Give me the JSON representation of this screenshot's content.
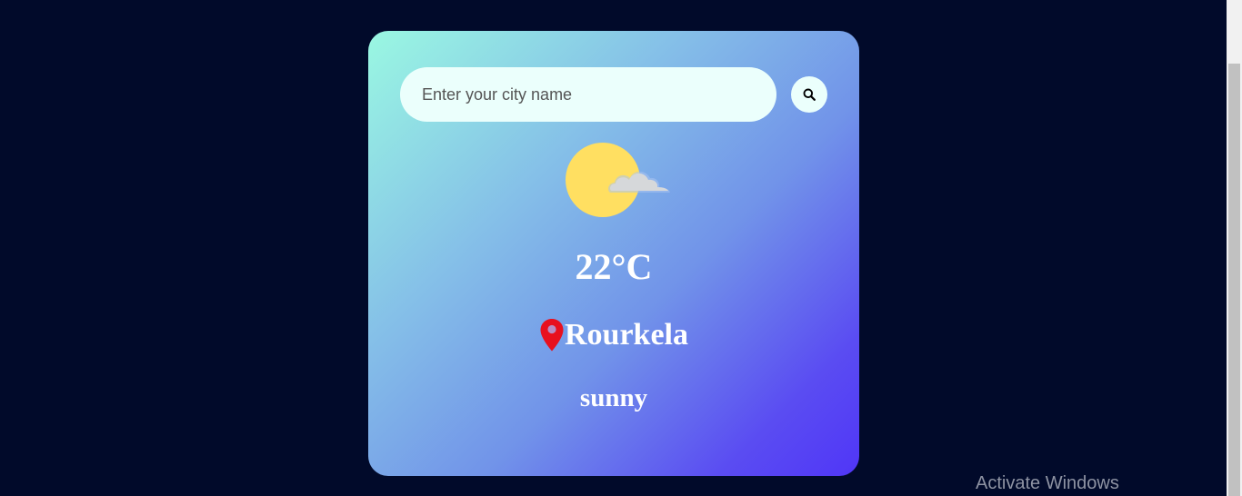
{
  "search": {
    "placeholder": "Enter your city name",
    "value": ""
  },
  "icons": {
    "search": "search-icon",
    "weather": "sun-behind-cloud-icon",
    "location": "location-pin-icon"
  },
  "weather": {
    "temperature": "22°C",
    "city": "Rourkela",
    "condition": "sunny"
  },
  "overlay": {
    "activate_windows": "Activate Windows"
  },
  "colors": {
    "background": "#010a2a",
    "card_gradient_start": "#9af8e2",
    "card_gradient_end": "#5036f7",
    "input_background": "#ebfffc",
    "sun": "#ffdf61",
    "cloud": "#d6d8da",
    "pin": "#e8101e"
  }
}
